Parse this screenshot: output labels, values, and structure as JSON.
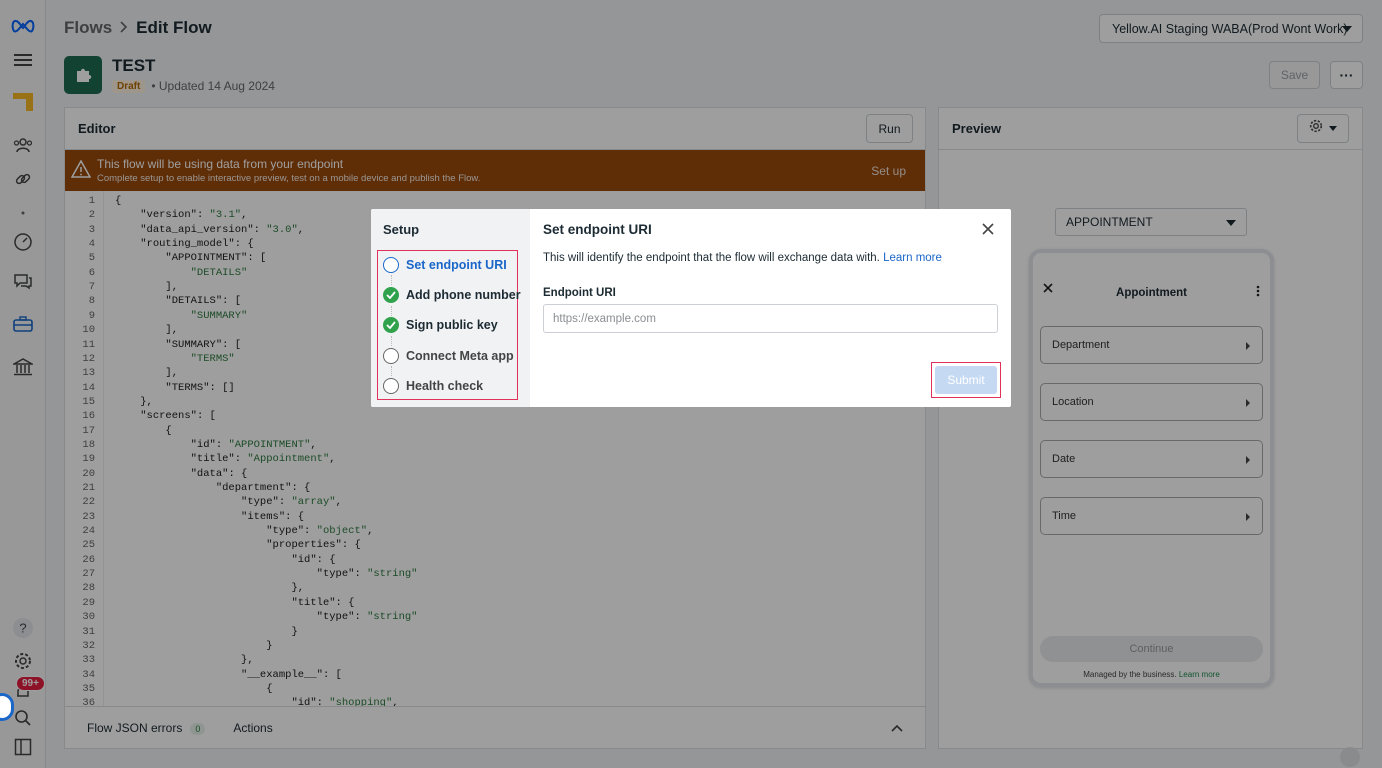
{
  "breadcrumb": {
    "parent": "Flows",
    "current": "Edit Flow"
  },
  "waba_selector": {
    "value": "Yellow.AI Staging WABA(Prod Wont Work)"
  },
  "flow": {
    "name": "TEST",
    "status": "Draft",
    "updated": "• Updated 14 Aug 2024"
  },
  "toolbar": {
    "save_label": "Save",
    "more_label": "···"
  },
  "rail": {
    "notification_count": "99+"
  },
  "editor": {
    "title": "Editor",
    "run_label": "Run",
    "warning_title": "This flow will be using data from your endpoint",
    "warning_subtitle": "Complete setup to enable interactive preview, test on a mobile device and publish the Flow.",
    "warning_action": "Set up",
    "code_lines": [
      "{",
      "    \"version\": \"3.1\",",
      "    \"data_api_version\": \"3.0\",",
      "    \"routing_model\": {",
      "        \"APPOINTMENT\": [",
      "            \"DETAILS\"",
      "        ],",
      "        \"DETAILS\": [",
      "            \"SUMMARY\"",
      "        ],",
      "        \"SUMMARY\": [",
      "            \"TERMS\"",
      "        ],",
      "        \"TERMS\": []",
      "    },",
      "    \"screens\": [",
      "        {",
      "            \"id\": \"APPOINTMENT\",",
      "            \"title\": \"Appointment\",",
      "            \"data\": {",
      "                \"department\": {",
      "                    \"type\": \"array\",",
      "                    \"items\": {",
      "                        \"type\": \"object\",",
      "                        \"properties\": {",
      "                            \"id\": {",
      "                                \"type\": \"string\"",
      "                            },",
      "                            \"title\": {",
      "                                \"type\": \"string\"",
      "                            }",
      "                        }",
      "                    },",
      "                    \"__example__\": [",
      "                        {",
      "                            \"id\": \"shopping\","
    ],
    "footer_errors_label": "Flow JSON errors",
    "footer_errors_count": "0",
    "footer_actions_label": "Actions"
  },
  "preview": {
    "title": "Preview",
    "screen_select": "APPOINTMENT",
    "phone_title": "Appointment",
    "fields": [
      "Department",
      "Location",
      "Date",
      "Time"
    ],
    "continue_label": "Continue",
    "managed_text": "Managed by the business.",
    "learn_more": "Learn more"
  },
  "modal": {
    "steps_title": "Setup",
    "steps": [
      {
        "label": "Set endpoint URI",
        "state": "active"
      },
      {
        "label": "Add phone number",
        "state": "done"
      },
      {
        "label": "Sign public key",
        "state": "done"
      },
      {
        "label": "Connect Meta app",
        "state": "pending"
      },
      {
        "label": "Health check",
        "state": "pending"
      }
    ],
    "title": "Set endpoint URI",
    "description": "This will identify the endpoint that the flow will exchange data with.",
    "learn_more": "Learn more",
    "field_label": "Endpoint URI",
    "field_placeholder": "https://example.com",
    "field_value": "",
    "submit_label": "Submit"
  },
  "colors": {
    "accent": "#1a66c9",
    "success": "#31a24c",
    "warning_bg": "#9a4a0b",
    "highlight": "#e0315a"
  }
}
